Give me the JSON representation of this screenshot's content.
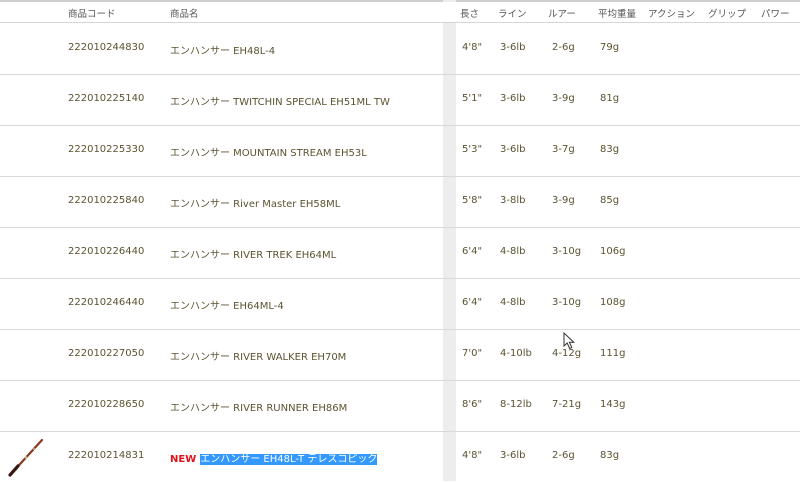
{
  "headers": {
    "code": "商品コード",
    "name": "商品名",
    "length": "長さ",
    "line": "ライン",
    "lure": "ルアー",
    "weight": "平均重量",
    "action": "アクション",
    "grip": "グリップ",
    "power": "パワー"
  },
  "rows": [
    {
      "code": "222010244830",
      "name": "エンハンサー EH48L-4",
      "length": "4'8\"",
      "line": "3-6lb",
      "lure": "2-6g",
      "weight": "79g"
    },
    {
      "code": "222010225140",
      "name": "エンハンサー TWITCHIN SPECIAL EH51ML TW",
      "length": "5'1\"",
      "line": "3-6lb",
      "lure": "3-9g",
      "weight": "81g"
    },
    {
      "code": "222010225330",
      "name": "エンハンサー MOUNTAIN STREAM EH53L",
      "length": "5'3\"",
      "line": "3-6lb",
      "lure": "3-7g",
      "weight": "83g"
    },
    {
      "code": "222010225840",
      "name": "エンハンサー River Master EH58ML",
      "length": "5'8\"",
      "line": "3-8lb",
      "lure": "3-9g",
      "weight": "85g"
    },
    {
      "code": "222010226440",
      "name": "エンハンサー RIVER TREK EH64ML",
      "length": "6'4\"",
      "line": "4-8lb",
      "lure": "3-10g",
      "weight": "106g"
    },
    {
      "code": "222010246440",
      "name": "エンハンサー EH64ML-4",
      "length": "6'4\"",
      "line": "4-8lb",
      "lure": "3-10g",
      "weight": "108g"
    },
    {
      "code": "222010227050",
      "name": "エンハンサー RIVER WALKER EH70M",
      "length": "7'0\"",
      "line": "4-10lb",
      "lure": "4-12g",
      "weight": "111g"
    },
    {
      "code": "222010228650",
      "name": "エンハンサー RIVER RUNNER EH86M",
      "length": "8'6\"",
      "line": "8-12lb",
      "lure": "7-21g",
      "weight": "143g"
    },
    {
      "code": "222010214831",
      "badge": "NEW",
      "name": "エンハンサー EH48L-T テレスコピック",
      "length": "4'8\"",
      "line": "3-6lb",
      "lure": "2-6g",
      "weight": "83g",
      "selected": true,
      "thumbnail": "rod-image"
    }
  ]
}
